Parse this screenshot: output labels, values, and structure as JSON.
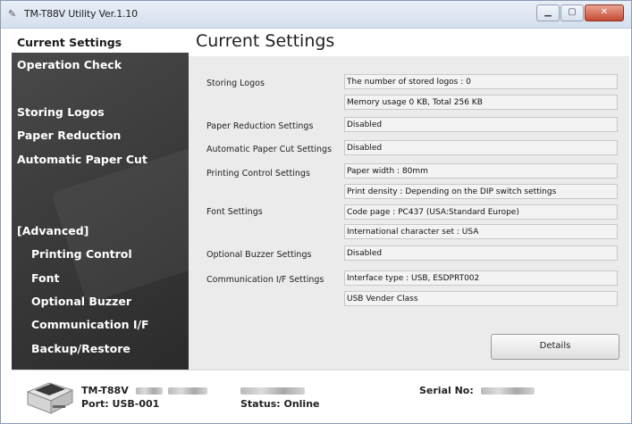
{
  "window": {
    "title": "TM-T88V Utility Ver.1.10"
  },
  "sidebar": {
    "items": [
      {
        "label": "Current Settings",
        "active": true
      },
      {
        "label": "Operation Check"
      },
      {
        "label": "Storing Logos"
      },
      {
        "label": "Paper Reduction"
      },
      {
        "label": "Automatic Paper Cut"
      },
      {
        "label": "[Advanced]"
      },
      {
        "label": "Printing Control"
      },
      {
        "label": "Font"
      },
      {
        "label": "Optional Buzzer"
      },
      {
        "label": "Communication I/F"
      },
      {
        "label": "Backup/Restore"
      }
    ]
  },
  "main": {
    "title": "Current Settings",
    "settings": [
      {
        "label": "Storing Logos",
        "values": [
          "The number of stored logos : 0",
          "Memory usage 0 KB, Total 256 KB"
        ]
      },
      {
        "label": "Paper Reduction Settings",
        "values": [
          "Disabled"
        ]
      },
      {
        "label": "Automatic Paper Cut Settings",
        "values": [
          "Disabled"
        ]
      },
      {
        "label": "Printing Control Settings",
        "values": [
          "Paper width : 80mm",
          "Print density : Depending on the DIP switch settings"
        ]
      },
      {
        "label": "Font Settings",
        "values": [
          "Code page : PC437 (USA:Standard Europe)",
          "International character set : USA"
        ]
      },
      {
        "label": "Optional Buzzer Settings",
        "values": [
          "Disabled"
        ]
      },
      {
        "label": "Communication I/F Settings",
        "values": [
          "Interface type : USB, ESDPRT002",
          "USB Vender Class"
        ]
      }
    ],
    "details_label": "Details"
  },
  "status": {
    "model": "TM-T88V",
    "port": "Port: USB-001",
    "status": "Status: Online",
    "serial_label": "Serial No:"
  }
}
